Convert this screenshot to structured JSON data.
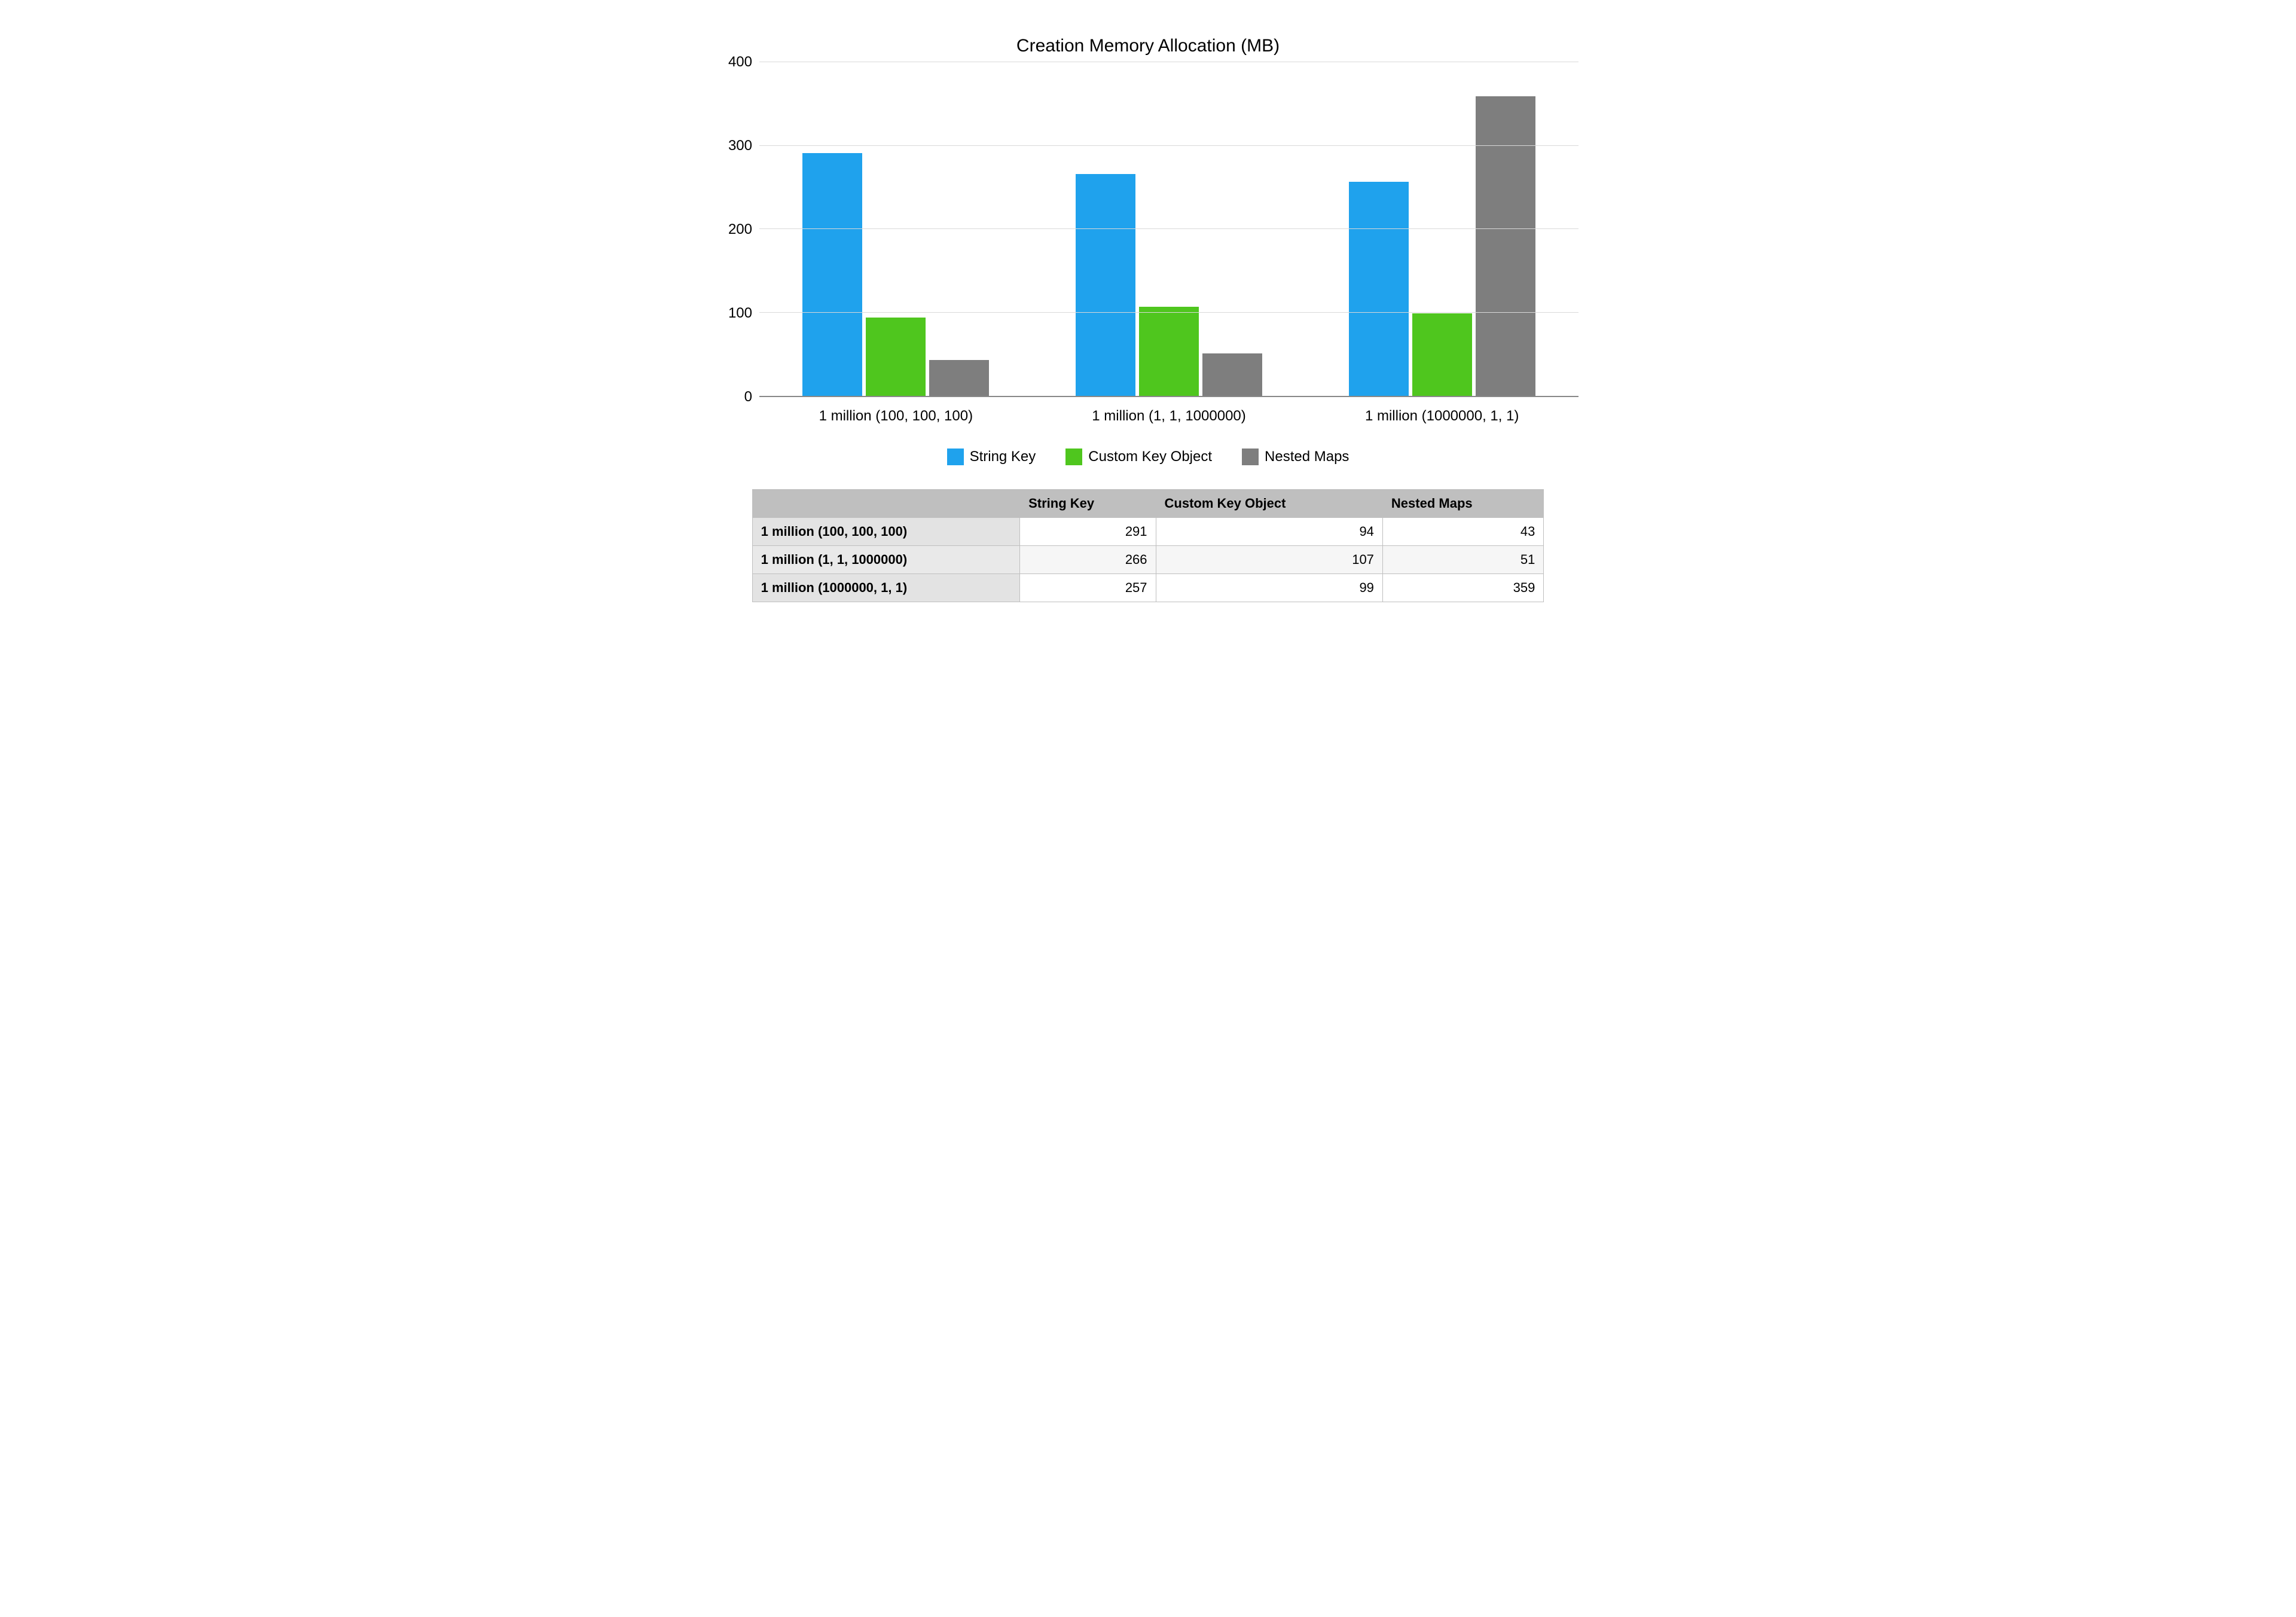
{
  "chart_data": {
    "type": "bar",
    "title": "Creation Memory Allocation (MB)",
    "xlabel": "",
    "ylabel": "",
    "ylim": [
      0,
      400
    ],
    "yticks": [
      0,
      100,
      200,
      300,
      400
    ],
    "categories": [
      "1 million (100, 100, 100)",
      "1 million (1, 1, 1000000)",
      "1 million (1000000, 1, 1)"
    ],
    "series": [
      {
        "name": "String Key",
        "color": "#1fa2ed",
        "values": [
          291,
          266,
          257
        ]
      },
      {
        "name": "Custom Key Object",
        "color": "#4fc61e",
        "values": [
          94,
          107,
          99
        ]
      },
      {
        "name": "Nested Maps",
        "color": "#7e7e7e",
        "values": [
          43,
          51,
          359
        ]
      }
    ]
  },
  "table": {
    "corner": "",
    "col_headers": [
      "String Key",
      "Custom Key Object",
      "Nested Maps"
    ],
    "rows": [
      {
        "label": "1 million (100, 100, 100)",
        "cells": [
          291,
          94,
          43
        ]
      },
      {
        "label": "1 million (1, 1, 1000000)",
        "cells": [
          266,
          107,
          51
        ]
      },
      {
        "label": "1 million (1000000, 1, 1)",
        "cells": [
          257,
          99,
          359
        ]
      }
    ]
  }
}
